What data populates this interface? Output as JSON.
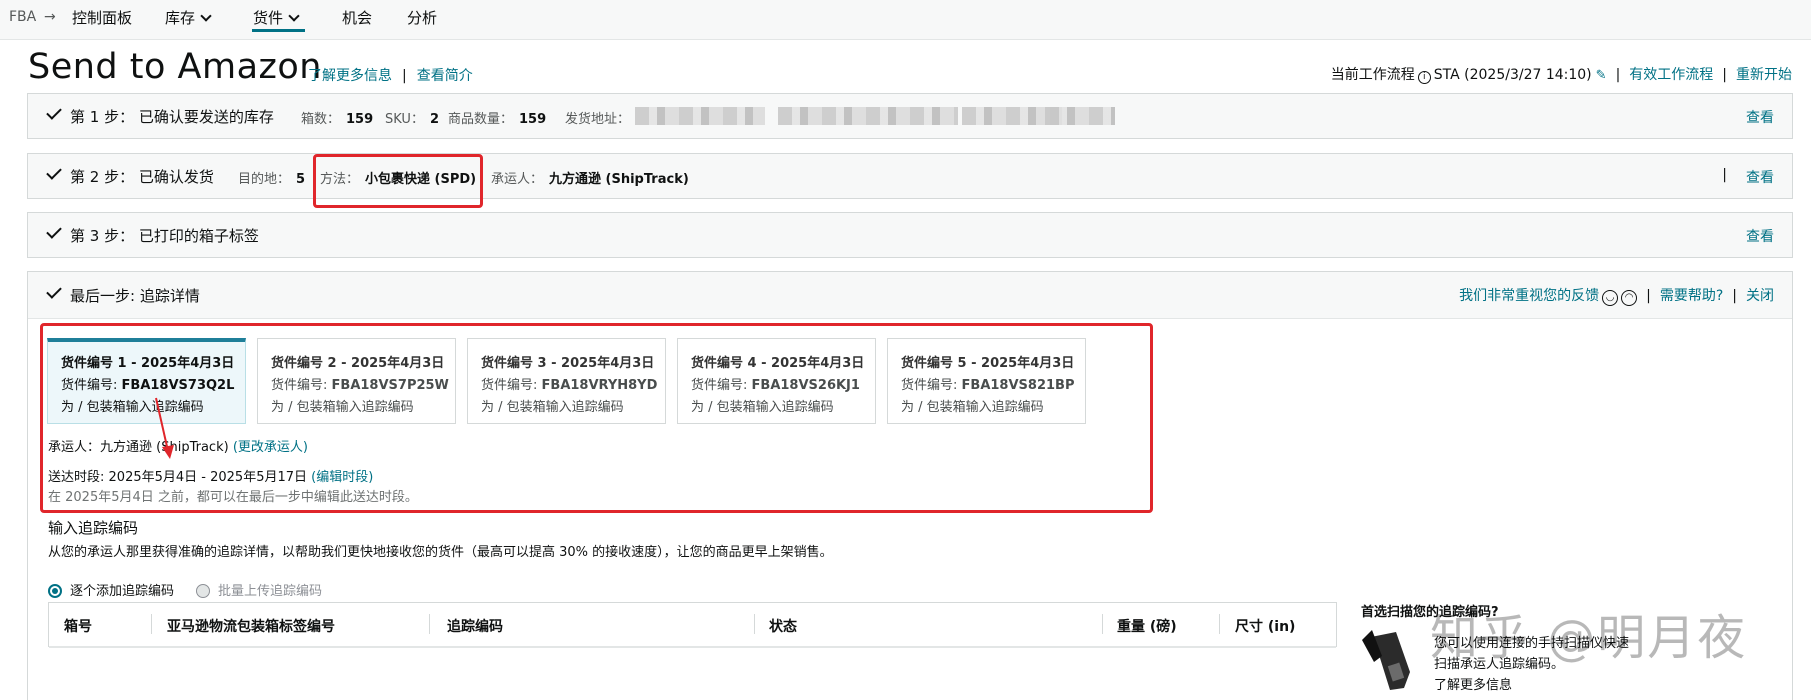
{
  "nav": {
    "crumb_root": "FBA",
    "items": [
      "控制面板",
      "库存",
      "货件",
      "机会",
      "分析"
    ]
  },
  "header": {
    "title": "Send to Amazon",
    "learn_more": "了解更多信息",
    "view_intro": "查看简介",
    "workflow_label": "当前工作流程",
    "workflow_value": "STA (2025/3/27 14:10)",
    "active_workflows": "有效工作流程",
    "restart": "重新开始"
  },
  "step1": {
    "title": "第 1 步：  已确认要发送的库存",
    "boxes_label": "箱数：",
    "boxes": "159",
    "sku_label": "SKU：",
    "sku": "2",
    "qty_label": "商品数量：",
    "qty": "159",
    "address_label": "发货地址：",
    "view": "查看"
  },
  "step2": {
    "title": "第 2 步：  已确认发货",
    "dest_label": "目的地：",
    "dest": "5",
    "method_label": "方法：",
    "method": "小包裹快递 (SPD)",
    "carrier_label": "承运人：",
    "carrier": "九方通逊 (ShipTrack)",
    "view": "查看"
  },
  "step3": {
    "title": "第 3 步：  已打印的箱子标签",
    "view": "查看"
  },
  "final": {
    "title": "最后一步: 追踪详情",
    "feedback": "我们非常重视您的反馈",
    "help": "需要帮助?",
    "close": "关闭",
    "shipments": [
      {
        "title": "货件编号 1 - 2025年4月3日",
        "id_label": "货件编号:",
        "id": "FBA18VS73Q2L",
        "action": "为 / 包装箱输入追踪编码"
      },
      {
        "title": "货件编号 2 - 2025年4月3日",
        "id_label": "货件编号:",
        "id": "FBA18VS7P25W",
        "action": "为 / 包装箱输入追踪编码"
      },
      {
        "title": "货件编号 3 - 2025年4月3日",
        "id_label": "货件编号:",
        "id": "FBA18VRYH8YD",
        "action": "为 / 包装箱输入追踪编码"
      },
      {
        "title": "货件编号 4 - 2025年4月3日",
        "id_label": "货件编号:",
        "id": "FBA18VS26KJ1",
        "action": "为 / 包装箱输入追踪编码"
      },
      {
        "title": "货件编号 5 - 2025年4月3日",
        "id_label": "货件编号:",
        "id": "FBA18VS821BP",
        "action": "为 / 包装箱输入追踪编码"
      }
    ],
    "carrier_label": "承运人：",
    "carrier": "九方通逊 (ShipTrack)",
    "change_carrier": "(更改承运人)",
    "window_label": "送达时段:",
    "window": "2025年5月4日 - 2025年5月17日",
    "edit_window": "(编辑时段)",
    "window_note": "在 2025年5月4日 之前，都可以在最后一步中编辑此送达时段。"
  },
  "tracking": {
    "title": "输入追踪编码",
    "desc": "从您的承运人那里获得准确的追踪详情，以帮助我们更快地接收您的货件（最高可以提高 30% 的接收速度），让您的商品更早上架销售。",
    "radio_one": "逐个添加追踪编码",
    "radio_bulk": "批量上传追踪编码",
    "columns": [
      "箱号",
      "亚马逊物流包装箱标签编号",
      "追踪编码",
      "状态",
      "重量 (磅)",
      "尺寸 (in)"
    ],
    "scan_title": "首选扫描您的追踪编码?",
    "scan_line1": "您可以使用连接的手持扫描仪快速",
    "scan_line2": "扫描承运人追踪编码。",
    "scan_learn": "了解更多信息"
  },
  "watermark": "知乎 @明月夜"
}
